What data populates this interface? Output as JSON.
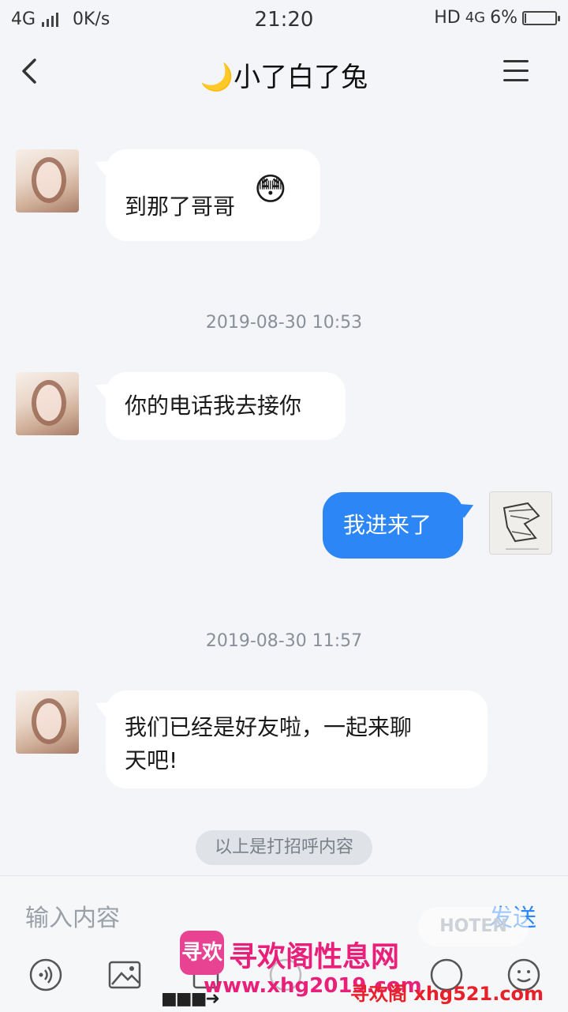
{
  "status_bar": {
    "network": "4G",
    "speed": "0K/s",
    "time": "21:20",
    "hd": "HD",
    "network_right": "4G",
    "battery": "6%",
    "battery_level": 0.06
  },
  "header": {
    "title": "🌙小了白了兔",
    "back_icon": "chevron-left-icon",
    "menu_icon": "menu-icon"
  },
  "messages": [
    {
      "side": "left",
      "text": "到那了哥哥",
      "emoji": "😳"
    },
    {
      "timestamp": "2019-08-30 10:53"
    },
    {
      "side": "left",
      "text": "你的电话我去接你"
    },
    {
      "side": "right",
      "text": "我进来了"
    },
    {
      "timestamp": "2019-08-30 11:57"
    },
    {
      "side": "left",
      "text_line1": "我们已经是好友啦，一起来聊",
      "text_line2": "天吧!"
    }
  ],
  "hint": "以上是打招呼内容",
  "input": {
    "placeholder": "输入内容",
    "send_label": "发送"
  },
  "toolbar_icons": [
    "voice-icon",
    "image-icon",
    "camera-icon",
    "location-icon",
    "gift-icon",
    "emoji-icon"
  ],
  "watermark": {
    "logo_text": "寻欢",
    "site_name": "寻欢阁性息网",
    "url1": "www.xhg2019.com",
    "url2": "寻欢阁 xhg521.com",
    "faded": "HOTEN"
  },
  "colors": {
    "accent": "#2d86f6",
    "background": "#f3f5f9",
    "watermark": "#e8207a"
  }
}
